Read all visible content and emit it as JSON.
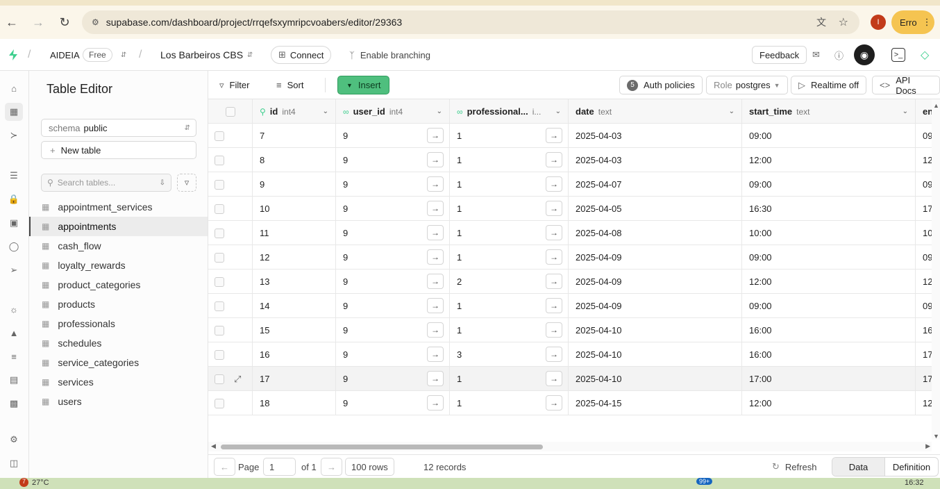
{
  "browser": {
    "url": "supabase.com/dashboard/project/rrqefsxymripcvoabers/editor/29363",
    "profile_initial": "I",
    "profile_label": "Erro"
  },
  "header": {
    "org": "AIDEIA",
    "plan": "Free",
    "project": "Los Barbeiros CBS",
    "connect": "Connect",
    "branching": "Enable branching",
    "feedback": "Feedback"
  },
  "sidebar": {
    "title": "Table Editor",
    "schema_label": "schema",
    "schema_value": "public",
    "new_table": "New table",
    "search_placeholder": "Search tables...",
    "tables": [
      "appointment_services",
      "appointments",
      "cash_flow",
      "loyalty_rewards",
      "product_categories",
      "products",
      "professionals",
      "schedules",
      "service_categories",
      "services",
      "users"
    ],
    "active_table": "appointments"
  },
  "toolbar": {
    "filter": "Filter",
    "sort": "Sort",
    "insert": "Insert",
    "auth_count": "5",
    "auth_policies": "Auth policies",
    "role_label": "Role",
    "role_value": "postgres",
    "realtime": "Realtime off",
    "api_docs": "API Docs"
  },
  "grid": {
    "columns": [
      {
        "name": "id",
        "type": "int4"
      },
      {
        "name": "user_id",
        "type": "int4"
      },
      {
        "name": "professional...",
        "type": "i..."
      },
      {
        "name": "date",
        "type": "text"
      },
      {
        "name": "start_time",
        "type": "text"
      },
      {
        "name": "en",
        "type": ""
      }
    ],
    "rows": [
      [
        "7",
        "9",
        "1",
        "2025-04-03",
        "09:00",
        "09"
      ],
      [
        "8",
        "9",
        "1",
        "2025-04-03",
        "12:00",
        "12"
      ],
      [
        "9",
        "9",
        "1",
        "2025-04-07",
        "09:00",
        "09"
      ],
      [
        "10",
        "9",
        "1",
        "2025-04-05",
        "16:30",
        "17"
      ],
      [
        "11",
        "9",
        "1",
        "2025-04-08",
        "10:00",
        "10"
      ],
      [
        "12",
        "9",
        "1",
        "2025-04-09",
        "09:00",
        "09"
      ],
      [
        "13",
        "9",
        "2",
        "2025-04-09",
        "12:00",
        "12"
      ],
      [
        "14",
        "9",
        "1",
        "2025-04-09",
        "09:00",
        "09"
      ],
      [
        "15",
        "9",
        "1",
        "2025-04-10",
        "16:00",
        "16"
      ],
      [
        "16",
        "9",
        "3",
        "2025-04-10",
        "16:00",
        "17"
      ],
      [
        "17",
        "9",
        "1",
        "2025-04-10",
        "17:00",
        "17"
      ],
      [
        "18",
        "9",
        "1",
        "2025-04-15",
        "12:00",
        "12"
      ]
    ]
  },
  "footer": {
    "page_label": "Page",
    "page_value": "1",
    "of_label": "of 1",
    "rows_label": "100 rows",
    "records": "12 records",
    "refresh": "Refresh",
    "data_tab": "Data",
    "definition_tab": "Definition"
  },
  "taskbar": {
    "weather": "27°C",
    "badge": "99+",
    "time": "16:32"
  }
}
